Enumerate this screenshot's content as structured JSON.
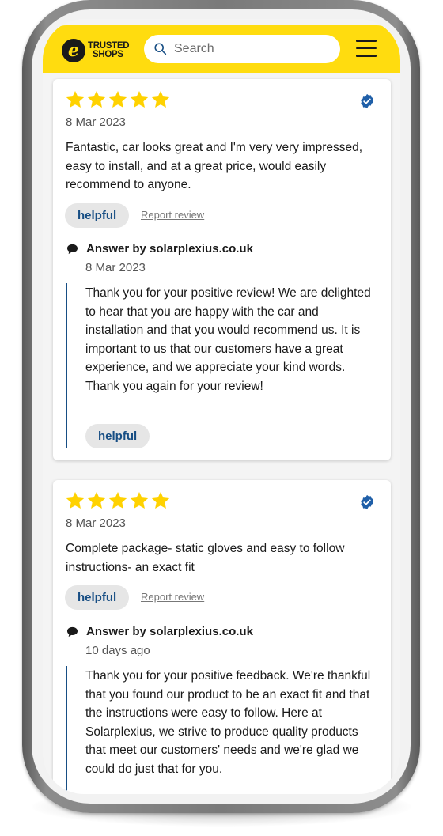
{
  "header": {
    "logo_line1": "TRUSTED",
    "logo_line2": "SHOPS",
    "logo_mark": "e",
    "search_placeholder": "Search",
    "menu_icon": "hamburger-menu-icon"
  },
  "colors": {
    "brand_yellow": "#ffdc0f",
    "star": "#ffd200",
    "accent_blue": "#174e84",
    "verified_blue": "#1f5fa8"
  },
  "reviews": [
    {
      "rating": 5,
      "date": "8 Mar 2023",
      "text": "Fantastic, car looks great and I'm very very impressed, easy to install, and at a great price, would easily recommend to anyone.",
      "helpful_label": "helpful",
      "report_label": "Report review",
      "answer": {
        "title": "Answer by solarplexius.co.uk",
        "date": "8 Mar 2023",
        "text": "Thank you for your positive review! We are delighted to hear that you are happy with the car and installation and that you would recommend us. It is important to us that our customers have a great experience, and we appreciate your kind words. Thank you again for your review!",
        "helpful_label": "helpful"
      }
    },
    {
      "rating": 5,
      "date": "8 Mar 2023",
      "text": "Complete package- static gloves and easy to follow instructions- an exact fit",
      "helpful_label": "helpful",
      "report_label": "Report review",
      "answer": {
        "title": "Answer by solarplexius.co.uk",
        "date": "10 days ago",
        "text": "Thank you for your positive feedback. We're thankful that you found our product to be an exact fit and that the instructions were easy to follow. Here at Solarplexius, we strive to produce quality products that meet our customers' needs and we're glad we could do just that for you."
      }
    }
  ]
}
